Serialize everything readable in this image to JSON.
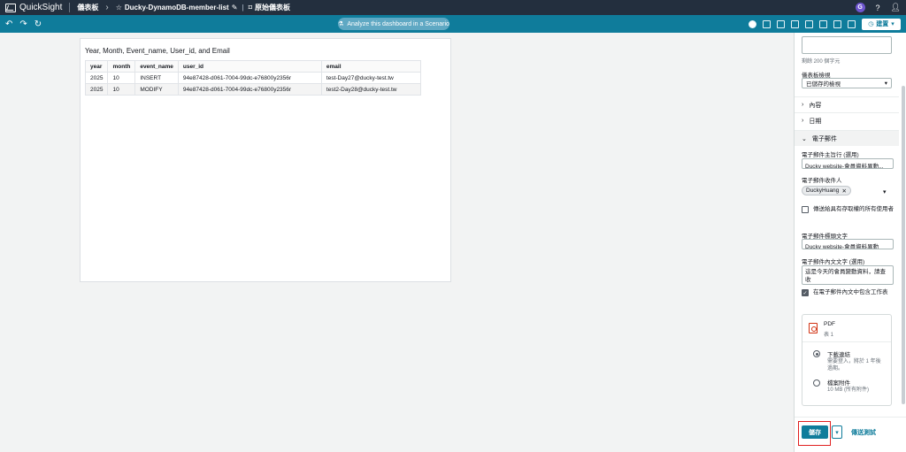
{
  "topbar": {
    "app_name": "QuickSight",
    "breadcrumb_home": "儀表板",
    "dashboard_name": "Ducky-DynamoDB-member-list",
    "original_dashboard": "原始儀表板",
    "user_initial": "G"
  },
  "toolbar": {
    "scenario_label": "Analyze this dashboard in a Scenario",
    "share_label": "建置"
  },
  "visual": {
    "title": "Year, Month, Event_name, User_id, and Email",
    "columns": [
      "year",
      "month",
      "event_name",
      "user_id",
      "email"
    ],
    "rows": [
      [
        "2025",
        "10",
        "INSERT",
        "94e87428-d061-7004-99dc-e76800y2356r",
        "test-Day27@ducky-test.tw"
      ],
      [
        "2025",
        "10",
        "MODIFY",
        "94e87428-d061-7004-99dc-e76800y2356r",
        "test2-Day28@ducky-test.tw"
      ]
    ]
  },
  "panel": {
    "remaining_chars": "剩餘 200 個字元",
    "dashboard_view_label": "儀表板檢視",
    "dashboard_view_value": "已儲存的檢視",
    "section_content": "內容",
    "section_date": "日期",
    "section_email": "電子郵件",
    "subject_label": "電子郵件主旨行 (選用)",
    "subject_value": "Ducky website-會員資料異動...",
    "recipients_label": "電子郵件收件人",
    "recipient_token": "DuckyHuang",
    "send_all_label": "傳送給具有存取權的所有使用者",
    "header_label": "電子郵件標頭文字",
    "header_value": "Ducky website-會員資料異動",
    "body_label": "電子郵件內文文字 (選用)",
    "body_value": "這是今天的會員變動資料，請查收",
    "include_sheet_label": "在電子郵件內文中包含工作表",
    "attachment_title": "PDF",
    "attachment_sub": "表 1",
    "option1_title": "下載連結",
    "option1_desc": "需要登入，將於 1 年後過期。",
    "option2_title": "檔案附件",
    "option2_desc": "10 MB (所有附件)",
    "save_label": "儲存",
    "send_test_label": "傳送測試"
  }
}
